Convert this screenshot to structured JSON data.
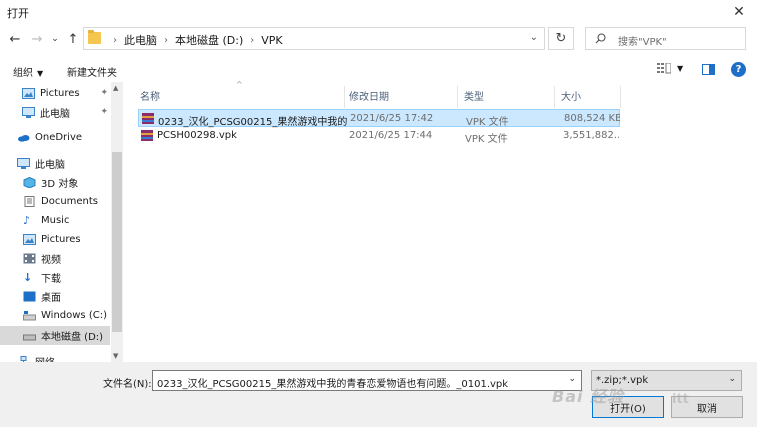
{
  "window": {
    "title": "打开",
    "close_glyph": "✕"
  },
  "nav": {
    "back_glyph": "←",
    "forward_glyph": "→",
    "recent_glyph": "⌄",
    "up_glyph": "↑",
    "breadcrumbs": [
      "此电脑",
      "本地磁盘 (D:)",
      "VPK"
    ],
    "crumb_separator": "›",
    "address_dropdown_glyph": "⌄",
    "refresh_glyph": "↻",
    "search_placeholder": "搜索\"VPK\""
  },
  "toolbar": {
    "organize_label": "组织",
    "new_folder_label": "新建文件夹",
    "help_label": "?"
  },
  "sidebar": {
    "items": [
      {
        "label": "Pictures",
        "icon": "pictures-icon",
        "pinned": true
      },
      {
        "label": "此电脑",
        "icon": "this-pc-icon",
        "pinned": true
      },
      {
        "label": "OneDrive",
        "icon": "onedrive-icon",
        "pinned": false
      },
      {
        "label": "此电脑",
        "icon": "this-pc-icon",
        "pinned": false
      },
      {
        "label": "3D 对象",
        "icon": "3d-objects-icon",
        "pinned": false
      },
      {
        "label": "Documents",
        "icon": "documents-icon",
        "pinned": false
      },
      {
        "label": "Music",
        "icon": "music-icon",
        "pinned": false
      },
      {
        "label": "Pictures",
        "icon": "pictures-icon",
        "pinned": false
      },
      {
        "label": "视频",
        "icon": "videos-icon",
        "pinned": false
      },
      {
        "label": "下载",
        "icon": "downloads-icon",
        "pinned": false
      },
      {
        "label": "桌面",
        "icon": "desktop-icon",
        "pinned": false
      },
      {
        "label": "Windows (C:)",
        "icon": "drive-icon",
        "pinned": false
      },
      {
        "label": "本地磁盘 (D:)",
        "icon": "drive-icon",
        "pinned": false,
        "selected": true
      },
      {
        "label": "网络",
        "icon": "network-icon",
        "pinned": false
      }
    ],
    "pin_glyph": "📌"
  },
  "file_list": {
    "columns": [
      "名称",
      "修改日期",
      "类型",
      "大小"
    ],
    "rows": [
      {
        "name": "0233_汉化_PCSG00215_果然游戏中我的...",
        "date": "2021/6/25 17:42",
        "type": "VPK 文件",
        "size": "808,524 KB",
        "selected": true
      },
      {
        "name": "PCSH00298.vpk",
        "date": "2021/6/25 17:44",
        "type": "VPK 文件",
        "size": "3,551,882...",
        "selected": false
      }
    ]
  },
  "footer": {
    "filename_label": "文件名(N):",
    "filename_value": "0233_汉化_PCSG00215_果然游戏中我的青春恋爱物语也有问题。_0101.vpk",
    "filetype_value": "*.zip;*.vpk",
    "open_button": "打开(O)",
    "cancel_button": "取消"
  },
  "watermark": {
    "text": "Bai 经验",
    "text2": "itt"
  },
  "colors": {
    "selection_bg": "#cce8ff",
    "selection_border": "#99d1ff",
    "accent": "#0078d7"
  }
}
